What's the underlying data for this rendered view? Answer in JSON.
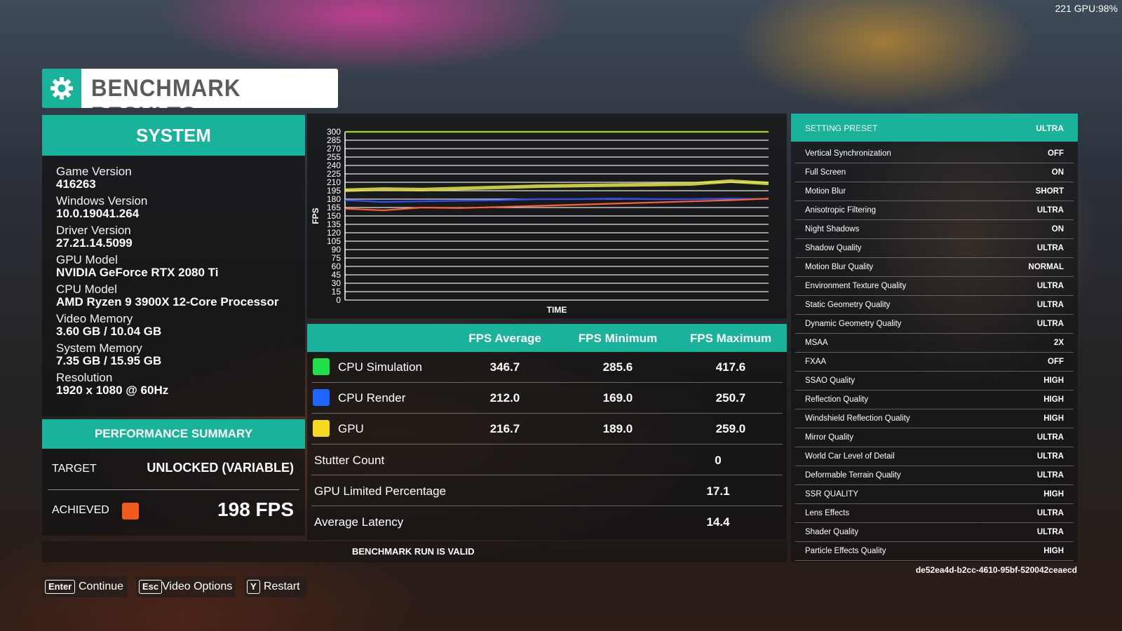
{
  "hud": {
    "text": "221 GPU:98%"
  },
  "header": {
    "title": "BENCHMARK RESULTS",
    "icon": "gear-icon"
  },
  "system": {
    "title": "SYSTEM",
    "items": [
      {
        "label": "Game Version",
        "value": "416263"
      },
      {
        "label": "Windows Version",
        "value": "10.0.19041.264"
      },
      {
        "label": "Driver Version",
        "value": "27.21.14.5099"
      },
      {
        "label": "GPU Model",
        "value": "NVIDIA GeForce RTX 2080 Ti"
      },
      {
        "label": "CPU Model",
        "value": "AMD Ryzen 9 3900X 12-Core Processor"
      },
      {
        "label": "Video Memory",
        "value": "3.60 GB / 10.04 GB"
      },
      {
        "label": "System Memory",
        "value": "7.35 GB / 15.95 GB"
      },
      {
        "label": "Resolution",
        "value": "1920 x 1080 @ 60Hz"
      }
    ]
  },
  "performance": {
    "title": "PERFORMANCE SUMMARY",
    "target_label": "TARGET",
    "target_value": "UNLOCKED (VARIABLE)",
    "achieved_label": "ACHIEVED",
    "achieved_value": "198 FPS",
    "achieved_color": "#f25a1c"
  },
  "chart_data": {
    "type": "line",
    "xlabel": "TIME",
    "ylabel": "FPS",
    "ylim": [
      0,
      300
    ],
    "yticks": [
      0,
      15,
      30,
      45,
      60,
      75,
      90,
      105,
      120,
      135,
      150,
      165,
      180,
      195,
      210,
      225,
      240,
      255,
      270,
      285,
      300
    ],
    "series": [
      {
        "color": "#9be000",
        "values": [
          300,
          300,
          300,
          300,
          300,
          300,
          300,
          300,
          300,
          300,
          300,
          300
        ]
      },
      {
        "color": "#e8e84a",
        "values": [
          196,
          198,
          197,
          199,
          201,
          203,
          204,
          205,
          206,
          207,
          212,
          208
        ]
      },
      {
        "color": "#3050ff",
        "values": [
          178,
          175,
          176,
          177,
          178,
          180,
          180,
          181,
          180,
          180,
          181,
          180
        ]
      },
      {
        "color": "#ff6030",
        "values": [
          163,
          160,
          165,
          164,
          166,
          168,
          170,
          172,
          174,
          176,
          178,
          181
        ]
      }
    ]
  },
  "fps_table": {
    "headers": [
      "FPS Average",
      "FPS Minimum",
      "FPS Maximum"
    ],
    "rows": [
      {
        "name": "CPU Simulation",
        "color": "#1ee04a",
        "avg": "346.7",
        "min": "285.6",
        "max": "417.6"
      },
      {
        "name": "CPU Render",
        "color": "#1e66ff",
        "avg": "212.0",
        "min": "169.0",
        "max": "250.7"
      },
      {
        "name": "GPU",
        "color": "#f5d91e",
        "avg": "216.7",
        "min": "189.0",
        "max": "259.0"
      }
    ],
    "stats": [
      {
        "name": "Stutter Count",
        "value": "0"
      },
      {
        "name": "GPU Limited Percentage",
        "value": "17.1"
      },
      {
        "name": "Average Latency",
        "value": "14.4"
      }
    ],
    "valid_text": "BENCHMARK RUN IS VALID"
  },
  "settings": {
    "preset_label": "SETTING PRESET",
    "preset_value": "ULTRA",
    "items": [
      {
        "label": "Vertical Synchronization",
        "value": "OFF"
      },
      {
        "label": "Full Screen",
        "value": "ON"
      },
      {
        "label": "Motion Blur",
        "value": "SHORT"
      },
      {
        "label": "Anisotropic Filtering",
        "value": "ULTRA"
      },
      {
        "label": "Night Shadows",
        "value": "ON"
      },
      {
        "label": "Shadow Quality",
        "value": "ULTRA"
      },
      {
        "label": "Motion Blur Quality",
        "value": "NORMAL"
      },
      {
        "label": "Environment Texture Quality",
        "value": "ULTRA"
      },
      {
        "label": "Static Geometry Quality",
        "value": "ULTRA"
      },
      {
        "label": "Dynamic Geometry Quality",
        "value": "ULTRA"
      },
      {
        "label": "MSAA",
        "value": "2X"
      },
      {
        "label": "FXAA",
        "value": "OFF"
      },
      {
        "label": "SSAO Quality",
        "value": "HIGH"
      },
      {
        "label": "Reflection Quality",
        "value": "HIGH"
      },
      {
        "label": "Windshield Reflection Quality",
        "value": "HIGH"
      },
      {
        "label": "Mirror Quality",
        "value": "ULTRA"
      },
      {
        "label": "World Car Level of Detail",
        "value": "ULTRA"
      },
      {
        "label": "Deformable Terrain Quality",
        "value": "ULTRA"
      },
      {
        "label": "SSR QUALITY",
        "value": "HIGH"
      },
      {
        "label": "Lens Effects",
        "value": "ULTRA"
      },
      {
        "label": "Shader Quality",
        "value": "ULTRA"
      },
      {
        "label": "Particle Effects Quality",
        "value": "HIGH"
      }
    ],
    "run_id": "de52ea4d-b2cc-4610-95bf-520042ceaecd"
  },
  "footer": {
    "buttons": [
      {
        "key": "Enter",
        "label": "Continue"
      },
      {
        "key": "Esc",
        "label": "Video Options"
      },
      {
        "key": "Y",
        "label": "Restart"
      }
    ]
  }
}
